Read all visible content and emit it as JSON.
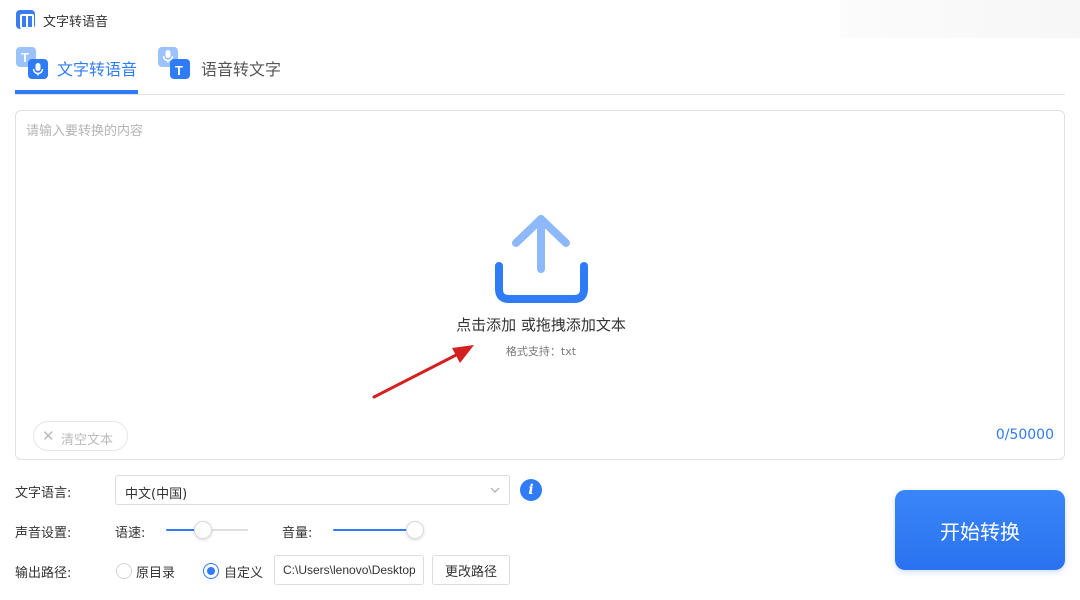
{
  "app": {
    "title": "文字转语音"
  },
  "tabs": [
    {
      "label": "文字转语音",
      "active": true
    },
    {
      "label": "语音转文字",
      "active": false
    }
  ],
  "editor": {
    "placeholder": "请输入要转换的内容",
    "upload_main": "点击添加 或拖拽添加文本",
    "upload_sub": "格式支持：txt",
    "clear_label": "清空文本",
    "char_count": "0/50000"
  },
  "settings": {
    "language_label": "文字语言:",
    "language_value": "中文(中国)",
    "voice_label": "声音设置:",
    "speed_label": "语速:",
    "speed_level": 0.45,
    "volume_label": "音量:",
    "volume_level": 1.0,
    "output_label": "输出路径:",
    "radio_original": "原目录",
    "radio_custom": "自定义",
    "selected_output": "custom",
    "output_path": "C:\\Users\\lenovo\\Desktop",
    "change_path_label": "更改路径"
  },
  "actions": {
    "start_label": "开始转换"
  },
  "colors": {
    "accent": "#2f7cf6",
    "annotation_arrow": "#d42020"
  }
}
